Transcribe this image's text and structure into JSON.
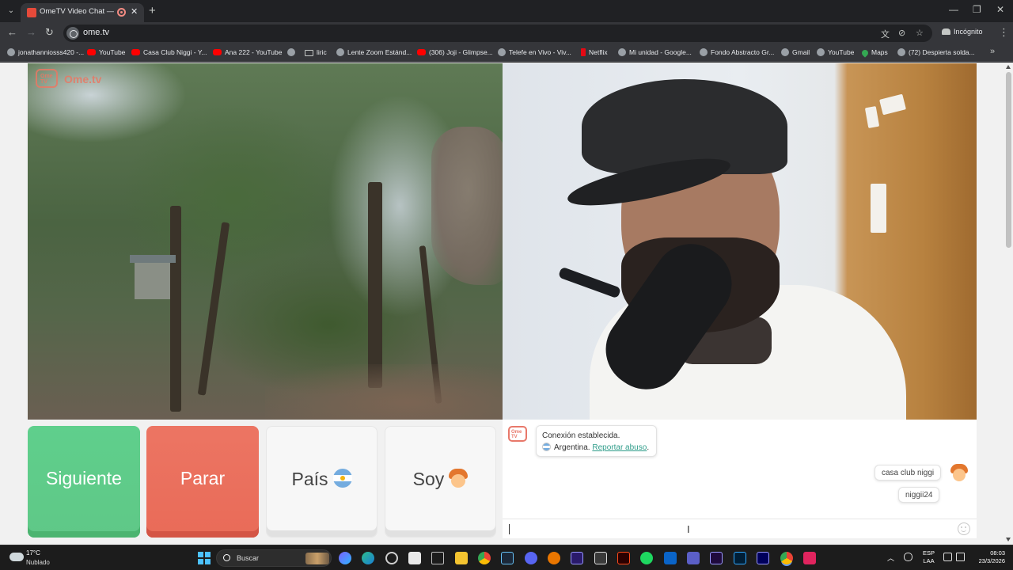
{
  "browser": {
    "tab_title": "OmeTV Video Chat — Ome",
    "url": "ome.tv",
    "incognito_label": "Incógnito"
  },
  "bookmarks": [
    {
      "label": "jonathanniosss420 -...",
      "icon": "site-icon"
    },
    {
      "label": "YouTube",
      "icon": "youtube-icon"
    },
    {
      "label": "Casa Club Niggi - Y...",
      "icon": "youtube-icon"
    },
    {
      "label": "Ana 222 - YouTube",
      "icon": "youtube-icon"
    },
    {
      "label": "",
      "icon": "site-icon"
    },
    {
      "label": "liric",
      "icon": "folder-icon"
    },
    {
      "label": "Lente Zoom Estánd...",
      "icon": "site-icon"
    },
    {
      "label": "(306) Joji - Glimpse...",
      "icon": "youtube-icon"
    },
    {
      "label": "Telefe en Vivo - Viv...",
      "icon": "site-icon"
    },
    {
      "label": "Netflix",
      "icon": "netflix-icon"
    },
    {
      "label": "Mi unidad - Google...",
      "icon": "site-icon"
    },
    {
      "label": "Fondo Abstracto Gr...",
      "icon": "site-icon"
    },
    {
      "label": "Gmail",
      "icon": "site-icon"
    },
    {
      "label": "YouTube",
      "icon": "site-icon"
    },
    {
      "label": "Maps",
      "icon": "maps-icon"
    },
    {
      "label": "(72) Despierta solda...",
      "icon": "site-icon"
    }
  ],
  "page": {
    "logo_text": "Ome.tv",
    "logo_badge": "Ome TV"
  },
  "controls": {
    "next_label": "Siguiente",
    "stop_label": "Parar",
    "country_label": "País",
    "gender_label": "Soy",
    "next_color": "#5fc887",
    "stop_color": "#e96b58"
  },
  "chat": {
    "system_line1": "Conexión establecida.",
    "system_country": "Argentina.",
    "system_report_link": "Reportar abuso",
    "system_period": ".",
    "messages": [
      "casa club niggi",
      "niggii24"
    ]
  },
  "taskbar": {
    "temperature": "17°C",
    "weather": "Nublado",
    "search_placeholder": "Buscar",
    "language_line1": "ESP",
    "language_line2": "LAA",
    "time": "08:03",
    "date": "23/3/2026"
  }
}
